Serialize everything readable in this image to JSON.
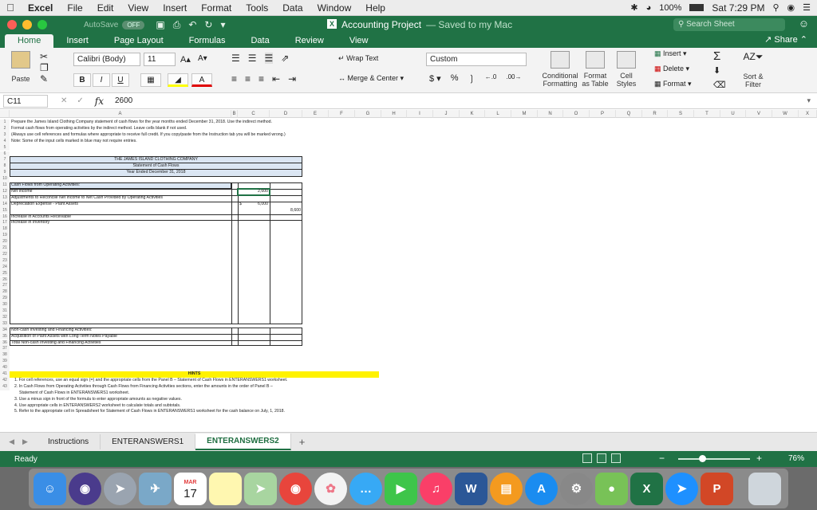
{
  "menubar": {
    "items": [
      "Excel",
      "File",
      "Edit",
      "View",
      "Insert",
      "Format",
      "Tools",
      "Data",
      "Window",
      "Help"
    ],
    "battery": "100%",
    "clock": "Sat 7:29 PM"
  },
  "titlebar": {
    "autosave_label": "AutoSave",
    "autosave_state": "OFF",
    "doc_name": "Accounting Project",
    "doc_status": "— Saved to my Mac",
    "search_placeholder": "Search Sheet"
  },
  "ribbon_tabs": [
    "Home",
    "Insert",
    "Page Layout",
    "Formulas",
    "Data",
    "Review",
    "View"
  ],
  "share_label": "Share",
  "ribbon": {
    "paste": "Paste",
    "font_name": "Calibri (Body)",
    "font_size": "11",
    "wrap_text": "Wrap Text",
    "merge_center": "Merge & Center",
    "number_format": "Custom",
    "conditional_formatting": "Conditional Formatting",
    "format_as_table": "Format as Table",
    "cell_styles": "Cell Styles",
    "insert": "Insert",
    "delete": "Delete",
    "format": "Format",
    "sort_filter": "Sort & Filter"
  },
  "formula_bar": {
    "name_box": "C11",
    "value": "2600"
  },
  "columns": [
    "A",
    "B",
    "C",
    "D",
    "E",
    "F",
    "G",
    "H",
    "I",
    "J",
    "K",
    "L",
    "M",
    "N",
    "O",
    "P",
    "Q",
    "R",
    "S",
    "T",
    "U",
    "V",
    "W",
    "X"
  ],
  "rows": [
    "1",
    "2",
    "3",
    "4",
    "5",
    "6",
    "7",
    "8",
    "9",
    "10",
    "11",
    "12",
    "13",
    "14",
    "15",
    "16",
    "17",
    "18",
    "19",
    "20",
    "21",
    "22",
    "23",
    "24",
    "25",
    "26",
    "27",
    "28",
    "29",
    "30",
    "31",
    "32",
    "33",
    "34",
    "35",
    "36",
    "37",
    "38",
    "39",
    "40",
    "41",
    "42",
    "43"
  ],
  "sheet": {
    "r1": "Prepare the James Island Clothing Company statement of cash flows for the year months ended December 31, 2018.  Use the indirect method.",
    "r2": "Format cash flows from operating activities by the indirect method. Leave cells blank if not used.",
    "r3": "(Always use cell references and formulas where appropriate to receive full credit. If you copy/paste from the Instruction tab you will be marked wrong.)",
    "r4": "Note:  Some of the input cells marked in blue may not require entries.",
    "h1": "THE JAMES ISLAND CLOTHING COMPANY",
    "h2": "Statement of Cash Flows",
    "h3": "Year Ended December 31, 2018",
    "r10": "Cash Flows from Operating Activities:",
    "r11": "Net Income",
    "r11c": "2,600",
    "r12": "Adjustments to Reconcile Net Income to Net Cash Provided by Operating Activities",
    "r13": "Depreciation Expense - Plant Assets",
    "r13dollar": "$",
    "r13c": "6,000",
    "r14d": "8,600",
    "r15": "Increase in Accounts Receivable",
    "r16": "Increase in Inventory",
    "r30": "Non-cash Investing and Financing Activities:",
    "r31": "Acquisition of Plant Assets with Long-Term Notes Payable",
    "r32": "Total Non-cash Investing and Financing Activities",
    "hints_title": "HINTS",
    "hint1": "1. For cell references, use an equal sign (=) and the appropriate cells from the Panel B – Statement of Cash Flows in ENTERANSWERS1 worksheet.",
    "hint2a": "2. In Cash Flows from Operating Activities through Cash Flows from Financing Activities sections, enter the amounts in the order of Panel B –",
    "hint2b": "Statement of Cash Flows in ENTERANSWERS1 worksheet.",
    "hint3": "3. Use a minus sign in front of the formula to enter appropriate amounts as negative values.",
    "hint4": "4. Use appropriate cells in ENTERANSWERS2 worksheet to calculate totals and subtotals.",
    "hint5": "5. Refer to the appropriate cell in Spreadsheet for Statement of Cash Flows in ENTERANSWERS1 worksheet for the cash balance on July, 1, 2018."
  },
  "sheet_tabs": [
    "Instructions",
    "ENTERANSWERS1",
    "ENTERANSWERS2"
  ],
  "status": {
    "ready": "Ready",
    "zoom": "76%"
  },
  "dock": {
    "calendar_month": "MAR",
    "calendar_day": "17"
  }
}
